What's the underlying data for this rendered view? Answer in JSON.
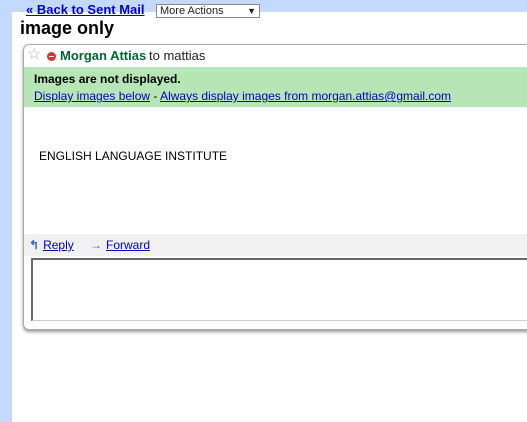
{
  "toolbar": {
    "back_link": "« Back to Sent Mail",
    "more_actions": "More Actions"
  },
  "message": {
    "subject": "image only",
    "sender": "Morgan Attias",
    "recipient_line": "to mattias",
    "body": "ENGLISH LANGUAGE INSTITUTE"
  },
  "images_banner": {
    "title": "Images are not displayed.",
    "display_below": "Display images below",
    "separator": " - ",
    "always_display": "Always display images from morgan.attias@gmail.com"
  },
  "actions": {
    "reply": "Reply",
    "forward": "Forward"
  },
  "colors": {
    "frame": "#c3d9ff",
    "banner": "#b6e6b6",
    "sender": "#006633",
    "link": "#0000cc"
  },
  "icons": [
    "star-icon",
    "presence-icon",
    "reply-arrow-icon",
    "forward-arrow-icon",
    "dropdown-arrow-icon"
  ]
}
